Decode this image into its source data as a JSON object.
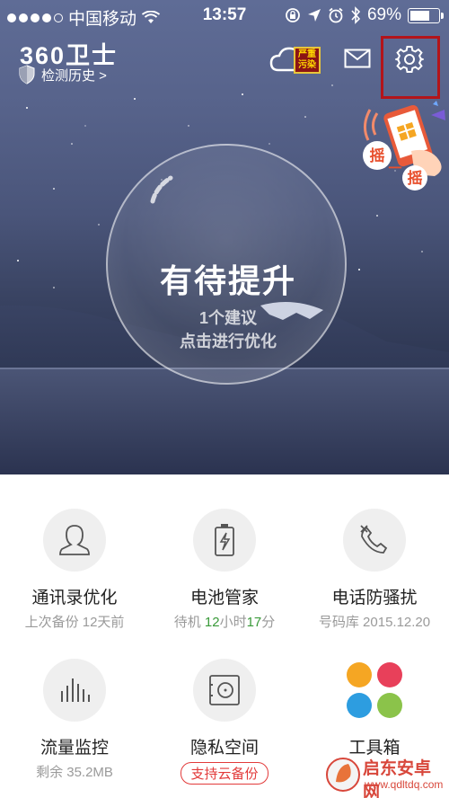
{
  "status_bar": {
    "carrier": "中国移动",
    "time": "13:57",
    "battery_percent": "69%",
    "battery_level": 0.69
  },
  "header": {
    "logo": "360卫士",
    "history_link": "检测历史 >",
    "pollution_badge": "严重污染",
    "icons": [
      "cloud-icon",
      "mail-icon",
      "gear-icon"
    ]
  },
  "shake_promo": {
    "text": "摇一摇"
  },
  "status_circle": {
    "title": "有待提升",
    "suggestion": "1个建议",
    "action": "点击进行优化"
  },
  "features": [
    {
      "title": "通讯录优化",
      "subtitle": "上次备份 12天前",
      "icon": "contact-icon"
    },
    {
      "title": "电池管家",
      "sub_prefix": "待机 ",
      "hours": "12",
      "sub_hours_unit": "小时",
      "minutes": "17",
      "sub_minutes_unit": "分",
      "icon": "battery-icon"
    },
    {
      "title": "电话防骚扰",
      "subtitle": "号码库 2015.12.20",
      "icon": "phone-block-icon"
    },
    {
      "title": "流量监控",
      "subtitle": "剩余 35.2MB",
      "icon": "traffic-icon"
    },
    {
      "title": "隐私空间",
      "badge": "支持云备份",
      "icon": "safe-icon"
    },
    {
      "title": "工具箱",
      "icon": "toolbox-icon"
    }
  ],
  "watermark": {
    "name": "启东安卓网",
    "url": "www.qdltdq.com"
  },
  "colors": {
    "highlight": "#b3141a",
    "badge_red": "#e23a3a",
    "green": "#3a9a3a",
    "tool_orange": "#f5a623",
    "tool_pink": "#e8405a",
    "tool_blue": "#2d9de0",
    "tool_green": "#8bc34a"
  }
}
